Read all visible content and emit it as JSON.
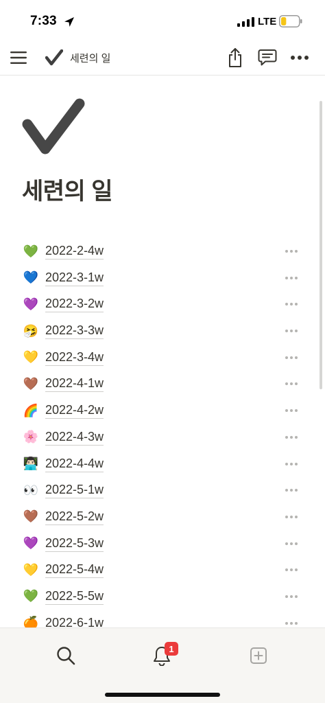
{
  "status_bar": {
    "time": "7:33",
    "network": "LTE",
    "battery_level": 0.3
  },
  "top_bar": {
    "breadcrumb_title": "세련의 일",
    "breadcrumb_icon": "checkmark-icon"
  },
  "page": {
    "icon": "✔",
    "title": "세련의 일"
  },
  "items": [
    {
      "emoji": "💚",
      "label": "2022-2-4w"
    },
    {
      "emoji": "💙",
      "label": "2022-3-1w"
    },
    {
      "emoji": "💜",
      "label": "2022-3-2w"
    },
    {
      "emoji": "🤧",
      "label": "2022-3-3w"
    },
    {
      "emoji": "💛",
      "label": "2022-3-4w"
    },
    {
      "emoji": "🤎",
      "label": "2022-4-1w"
    },
    {
      "emoji": "🌈",
      "label": "2022-4-2w"
    },
    {
      "emoji": "🌸",
      "label": "2022-4-3w"
    },
    {
      "emoji": "👨🏻‍💻",
      "label": "2022-4-4w"
    },
    {
      "emoji": "👀",
      "label": "2022-5-1w"
    },
    {
      "emoji": "🤎",
      "label": "2022-5-2w"
    },
    {
      "emoji": "💜",
      "label": "2022-5-3w"
    },
    {
      "emoji": "💛",
      "label": "2022-5-4w"
    },
    {
      "emoji": "💚",
      "label": "2022-5-5w"
    },
    {
      "emoji": "🍊",
      "label": "2022-6-1w"
    }
  ],
  "bottom_bar": {
    "updates_badge": "1"
  },
  "colors": {
    "text": "#37352f",
    "badge": "#eb3b3b",
    "battery": "#f5c518"
  }
}
